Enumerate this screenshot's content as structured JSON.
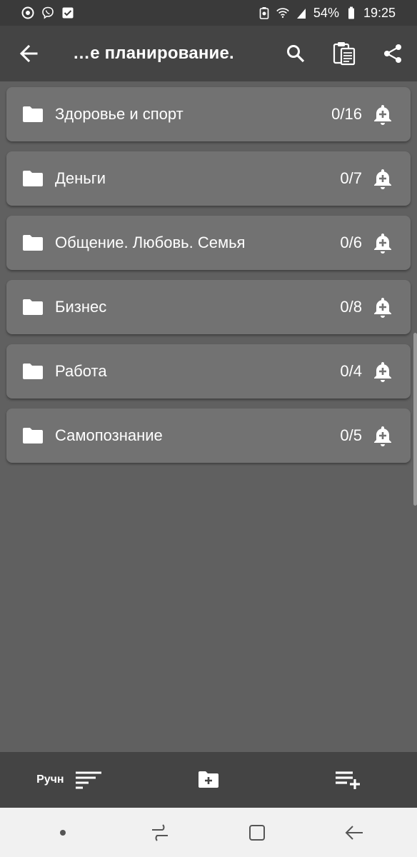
{
  "status_bar": {
    "battery_percent": "54%",
    "time": "19:25",
    "icons": [
      "chrome-icon",
      "viber-icon",
      "checkbox-icon",
      "battery-saver-icon",
      "wifi-icon",
      "signal-icon",
      "battery-icon"
    ]
  },
  "app_bar": {
    "title": "…е планирование.",
    "icons": [
      "back-arrow-icon",
      "search-icon",
      "clipboard-icon",
      "share-icon"
    ]
  },
  "folders": [
    {
      "name": "Здоровье и спорт",
      "count": "0/16"
    },
    {
      "name": "Деньги",
      "count": "0/7"
    },
    {
      "name": "Общение. Любовь. Семья",
      "count": "0/6"
    },
    {
      "name": "Бизнес",
      "count": "0/8"
    },
    {
      "name": "Работа",
      "count": "0/4"
    },
    {
      "name": "Самопознание",
      "count": "0/5"
    }
  ],
  "bottom_bar": {
    "sort_label": "Ручн",
    "icons": [
      "sort-icon",
      "add-folder-icon",
      "add-list-icon"
    ]
  },
  "colors": {
    "background": "#606060",
    "card": "#727272",
    "bars": "#444444",
    "status_bar": "#3a3a3a",
    "nav_bar": "#f1f1f1"
  }
}
